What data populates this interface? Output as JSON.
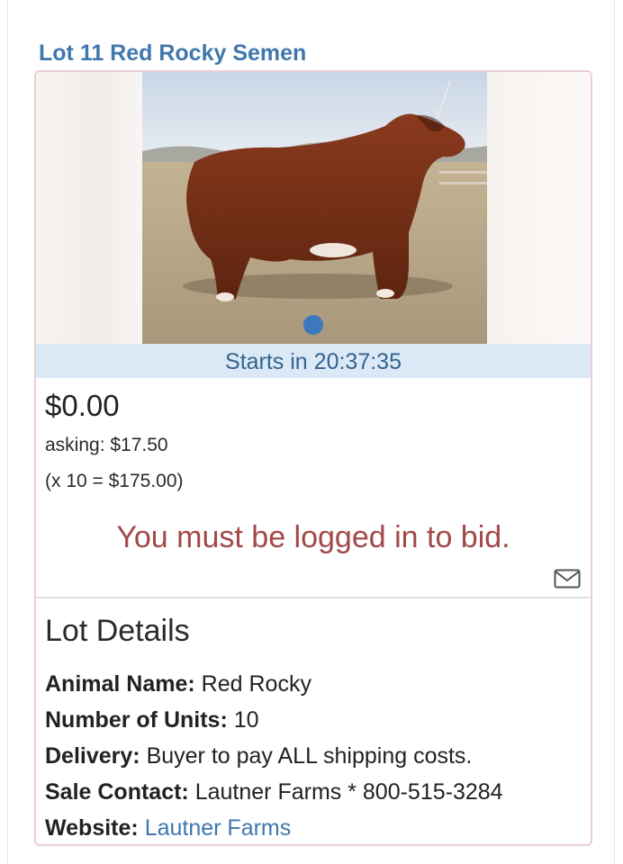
{
  "lot": {
    "title": "Lot 11 Red Rocky Semen",
    "countdown": "Starts in 20:37:35",
    "price": "$0.00",
    "asking": "asking: $17.50",
    "multiplier": "(x 10 = $175.00)",
    "login_message": "You must be logged in to bid.",
    "mail_icon": "envelope-icon"
  },
  "details": {
    "heading": "Lot Details",
    "rows": [
      {
        "label": "Animal Name:",
        "value": "Red Rocky"
      },
      {
        "label": "Number of Units:",
        "value": "10"
      },
      {
        "label": "Delivery:",
        "value": "Buyer to pay ALL shipping costs."
      },
      {
        "label": "Sale Contact:",
        "value": "Lautner Farms * 800-515-3284"
      },
      {
        "label": "Website:",
        "value": "Lautner Farms"
      }
    ]
  },
  "colors": {
    "accent": "#3f77ad",
    "countdown_bg": "#dbe8f6",
    "warning_text": "#a34848",
    "card_border": "#eacfd6"
  }
}
